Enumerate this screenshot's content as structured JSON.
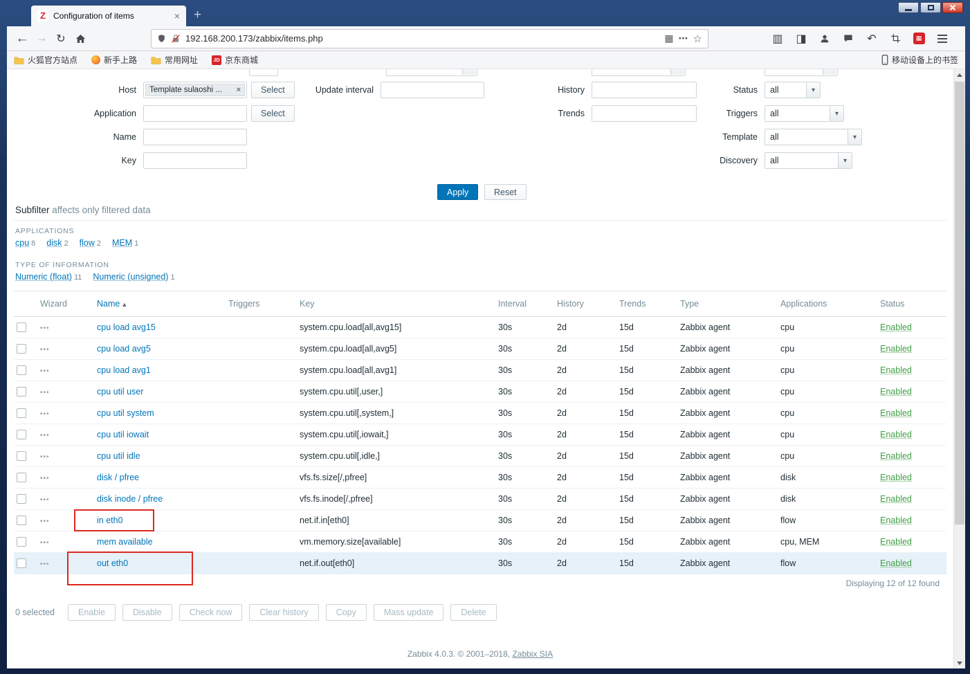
{
  "browser": {
    "tab_title": "Configuration of items",
    "tab_favicon": "Z",
    "tab_close": "×",
    "new_tab": "+",
    "url": "192.168.200.173/zabbix/items.php",
    "bookmarks": {
      "item1": "火狐官方站点",
      "item2": "新手上路",
      "item3": "常用网址",
      "item4": "京东商城",
      "item4_badge": "JD",
      "mobile": "移动设备上的书签"
    }
  },
  "icons": {
    "back": "←",
    "forward": "→",
    "refresh": "↻",
    "grid": "▦",
    "more": "⋯",
    "star": "☆",
    "library": "▥",
    "sidebar": "◨",
    "undo": "↶",
    "extension": "▦",
    "dropdown": "▾"
  },
  "filter": {
    "host": {
      "label": "Host",
      "value": "Template sulaoshi ...",
      "remove": "×",
      "select": "Select"
    },
    "application": {
      "label": "Application",
      "value": "",
      "select": "Select"
    },
    "name": {
      "label": "Name",
      "value": ""
    },
    "key": {
      "label": "Key",
      "value": ""
    },
    "update_interval": {
      "label": "Update interval",
      "value": ""
    },
    "history": {
      "label": "History",
      "value": ""
    },
    "trends": {
      "label": "Trends",
      "value": ""
    },
    "status": {
      "label": "Status",
      "value": "all"
    },
    "triggers": {
      "label": "Triggers",
      "value": "all"
    },
    "template": {
      "label": "Template",
      "value": "all"
    },
    "discovery": {
      "label": "Discovery",
      "value": "all"
    },
    "apply": "Apply",
    "reset": "Reset"
  },
  "subfilter": {
    "title": "Subfilter",
    "subtitle": "affects only filtered data",
    "applications_heading": "APPLICATIONS",
    "applications": [
      {
        "label": "cpu",
        "count": "8"
      },
      {
        "label": "disk",
        "count": "2"
      },
      {
        "label": "flow",
        "count": "2"
      },
      {
        "label": "MEM",
        "count": "1"
      }
    ],
    "types_heading": "TYPE OF INFORMATION",
    "types": [
      {
        "label": "Numeric (float)",
        "count": "11"
      },
      {
        "label": "Numeric (unsigned)",
        "count": "1"
      }
    ]
  },
  "table": {
    "wizard_icon": "•••",
    "headers": {
      "wizard": "Wizard",
      "name": "Name",
      "sort": "▲",
      "triggers": "Triggers",
      "key": "Key",
      "interval": "Interval",
      "history": "History",
      "trends": "Trends",
      "type": "Type",
      "applications": "Applications",
      "status": "Status"
    },
    "rows": [
      {
        "name": "cpu load avg15",
        "triggers": "",
        "key": "system.cpu.load[all,avg15]",
        "interval": "30s",
        "history": "2d",
        "trends": "15d",
        "type": "Zabbix agent",
        "applications": "cpu",
        "status": "Enabled",
        "row_highlight": false
      },
      {
        "name": "cpu load avg5",
        "triggers": "",
        "key": "system.cpu.load[all,avg5]",
        "interval": "30s",
        "history": "2d",
        "trends": "15d",
        "type": "Zabbix agent",
        "applications": "cpu",
        "status": "Enabled",
        "row_highlight": false
      },
      {
        "name": "cpu load avg1",
        "triggers": "",
        "key": "system.cpu.load[all,avg1]",
        "interval": "30s",
        "history": "2d",
        "trends": "15d",
        "type": "Zabbix agent",
        "applications": "cpu",
        "status": "Enabled",
        "row_highlight": false
      },
      {
        "name": "cpu util user",
        "triggers": "",
        "key": "system.cpu.util[,user,]",
        "interval": "30s",
        "history": "2d",
        "trends": "15d",
        "type": "Zabbix agent",
        "applications": "cpu",
        "status": "Enabled",
        "row_highlight": false
      },
      {
        "name": "cpu util system",
        "triggers": "",
        "key": "system.cpu.util[,system,]",
        "interval": "30s",
        "history": "2d",
        "trends": "15d",
        "type": "Zabbix agent",
        "applications": "cpu",
        "status": "Enabled",
        "row_highlight": false
      },
      {
        "name": "cpu util iowait",
        "triggers": "",
        "key": "system.cpu.util[,iowait,]",
        "interval": "30s",
        "history": "2d",
        "trends": "15d",
        "type": "Zabbix agent",
        "applications": "cpu",
        "status": "Enabled",
        "row_highlight": false
      },
      {
        "name": "cpu util idle",
        "triggers": "",
        "key": "system.cpu.util[,idle,]",
        "interval": "30s",
        "history": "2d",
        "trends": "15d",
        "type": "Zabbix agent",
        "applications": "cpu",
        "status": "Enabled",
        "row_highlight": false
      },
      {
        "name": "disk / pfree",
        "triggers": "",
        "key": "vfs.fs.size[/,pfree]",
        "interval": "30s",
        "history": "2d",
        "trends": "15d",
        "type": "Zabbix agent",
        "applications": "disk",
        "status": "Enabled",
        "row_highlight": false
      },
      {
        "name": "disk inode / pfree",
        "triggers": "",
        "key": "vfs.fs.inode[/,pfree]",
        "interval": "30s",
        "history": "2d",
        "trends": "15d",
        "type": "Zabbix agent",
        "applications": "disk",
        "status": "Enabled",
        "row_highlight": false
      },
      {
        "name": "in eth0",
        "triggers": "",
        "key": "net.if.in[eth0]",
        "interval": "30s",
        "history": "2d",
        "trends": "15d",
        "type": "Zabbix agent",
        "applications": "flow",
        "status": "Enabled",
        "row_highlight": false
      },
      {
        "name": "mem available",
        "triggers": "",
        "key": "vm.memory.size[available]",
        "interval": "30s",
        "history": "2d",
        "trends": "15d",
        "type": "Zabbix agent",
        "applications": "cpu, MEM",
        "status": "Enabled",
        "row_highlight": false
      },
      {
        "name": "out eth0",
        "triggers": "",
        "key": "net.if.out[eth0]",
        "interval": "30s",
        "history": "2d",
        "trends": "15d",
        "type": "Zabbix agent",
        "applications": "flow",
        "status": "Enabled",
        "row_highlight": true
      }
    ],
    "summary": "Displaying 12 of 12 found"
  },
  "annotations": [
    {
      "target": "in eth0"
    },
    {
      "target": "out eth0"
    }
  ],
  "action_bar": {
    "selected": "0 selected",
    "buttons": [
      "Enable",
      "Disable",
      "Check now",
      "Clear history",
      "Copy",
      "Mass update",
      "Delete"
    ]
  },
  "footer": {
    "text": "Zabbix 4.0.3. © 2001–2018, ",
    "link": "Zabbix SIA"
  },
  "colors": {
    "accent_blue": "#0275b8",
    "enabled_green": "#429e47",
    "annotation_red": "#dd281f"
  }
}
